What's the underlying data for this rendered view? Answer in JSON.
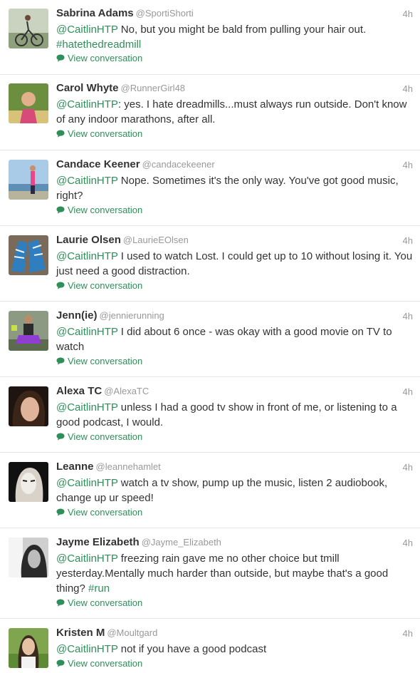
{
  "view_conversation": "View conversation",
  "tweets": [
    {
      "name": "Sabrina Adams",
      "handle": "@SportiShorti",
      "time": "4h",
      "mention": "@CaitlinHTP",
      "text": " No, but you might be bald from pulling your hair out.",
      "hashtag": "#hatethedreadmill"
    },
    {
      "name": "Carol Whyte",
      "handle": "@RunnerGirl48",
      "time": "4h",
      "mention": "@CaitlinHTP",
      "text": ": yes. I hate dreadmills...must always run outside. Don't know of any indoor marathons, after all."
    },
    {
      "name": "Candace Keener",
      "handle": "@candacekeener",
      "time": "4h",
      "mention": "@CaitlinHTP",
      "text": " Nope. Sometimes it's the only way. You've got good music, right?"
    },
    {
      "name": "Laurie Olsen",
      "handle": "@LaurieEOlsen",
      "time": "4h",
      "mention": "@CaitlinHTP",
      "text": " I used to watch Lost. I could get up to 10 without losing it. You just need a good distraction."
    },
    {
      "name": "Jenn(ie)",
      "handle": "@jennierunning",
      "time": "4h",
      "mention": "@CaitlinHTP",
      "text": " I did about 6 once - was okay with a good movie on TV to watch"
    },
    {
      "name": "Alexa TC",
      "handle": "@AlexaTC",
      "time": "4h",
      "mention": "@CaitlinHTP",
      "text": " unless I had a good tv show in front of me, or listening to a good podcast, I would."
    },
    {
      "name": "Leanne",
      "handle": "@leannehamlet",
      "time": "4h",
      "mention": "@CaitlinHTP",
      "text": " watch a tv show, pump up the music, listen 2 audiobook, change up ur speed!"
    },
    {
      "name": "Jayme Elizabeth",
      "handle": "@Jayme_Elizabeth",
      "time": "4h",
      "mention": "@CaitlinHTP",
      "text": " freezing rain gave me no other choice but tmill yesterday.Mentally much harder than outside, but maybe that's a good thing? ",
      "hashtag": "#run"
    },
    {
      "name": "Kristen M",
      "handle": "@Moultgard",
      "time": "4h",
      "mention": "@CaitlinHTP",
      "text": " not if you have a good podcast"
    }
  ]
}
